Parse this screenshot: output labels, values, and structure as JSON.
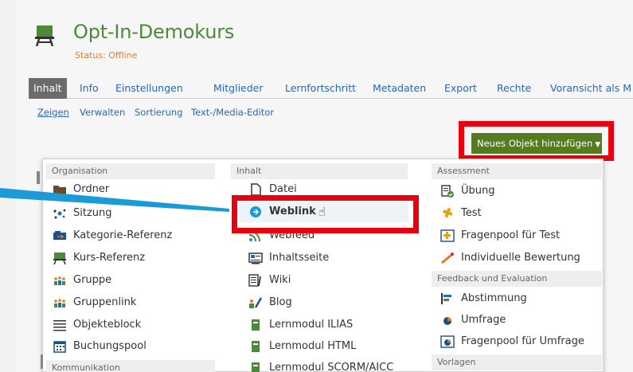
{
  "header": {
    "title": "Opt-In-Demokurs",
    "status": "Status: Offline",
    "icon": "course-icon"
  },
  "tabs": [
    {
      "label": "Inhalt",
      "active": true
    },
    {
      "label": "Info"
    },
    {
      "label": "Einstellungen"
    },
    {
      "label": "Mitglieder"
    },
    {
      "label": "Lernfortschritt"
    },
    {
      "label": "Metadaten"
    },
    {
      "label": "Export"
    },
    {
      "label": "Rechte"
    },
    {
      "label": "Voransicht als M"
    }
  ],
  "subtabs": [
    {
      "label": "Zeigen",
      "active": true
    },
    {
      "label": "Verwalten"
    },
    {
      "label": "Sortierung"
    },
    {
      "label": "Text-/Media-Editor"
    }
  ],
  "add_button": {
    "label": "Neues Objekt hinzufügen"
  },
  "menu": {
    "organisation": {
      "heading": "Organisation",
      "items": [
        "Ordner",
        "Sitzung",
        "Kategorie-Referenz",
        "Kurs-Referenz",
        "Gruppe",
        "Gruppenlink",
        "Objekteblock",
        "Buchungspool"
      ]
    },
    "kommunikation": {
      "heading": "Kommunikation"
    },
    "inhalt": {
      "heading": "Inhalt",
      "items": [
        "Datei",
        "Weblink",
        "Webfeed",
        "Inhaltsseite",
        "Wiki",
        "Blog",
        "Lernmodul ILIAS",
        "Lernmodul HTML",
        "Lernmodul SCORM/AICC"
      ]
    },
    "assessment": {
      "heading": "Assessment",
      "items": [
        "Übung",
        "Test",
        "Fragenpool für Test",
        "Individuelle Bewertung"
      ]
    },
    "feedback": {
      "heading": "Feedback und Evaluation",
      "items": [
        "Abstimmung",
        "Umfrage",
        "Fragenpool für Umfrage"
      ]
    },
    "vorlagen": {
      "heading": "Vorlagen"
    }
  },
  "colors": {
    "title_green": "#4c8a3a",
    "button_green": "#557a20",
    "highlight_red": "#e8000e",
    "arrow_blue": "#1a9ad6",
    "status_orange": "#d9822b"
  }
}
